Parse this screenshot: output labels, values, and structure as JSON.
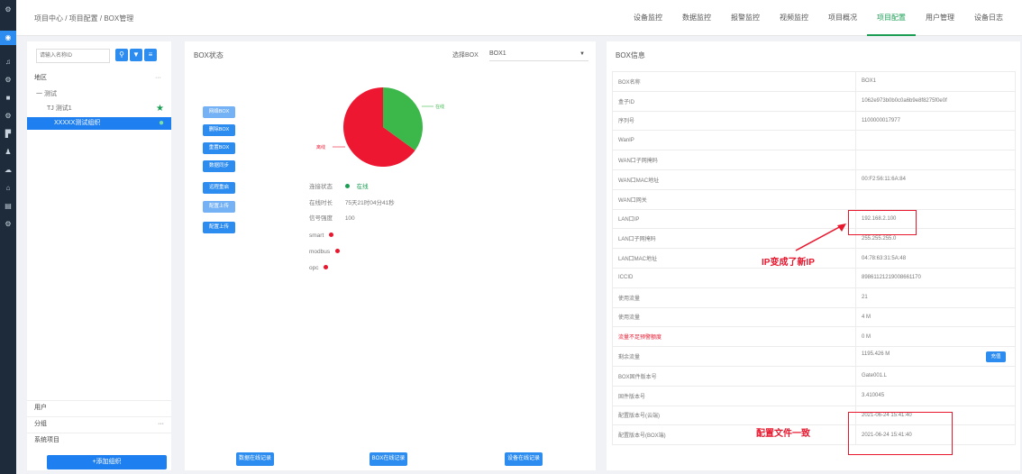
{
  "sidebar_icons": [
    "gear-icon",
    "home-icon",
    "bell-icon",
    "grid-icon",
    "monitor-icon",
    "database-icon",
    "flag-icon",
    "user-icon",
    "cloud-icon",
    "wrench-icon",
    "list-icon",
    "settings-icon"
  ],
  "header": {
    "breadcrumb": "项目中心 / 项目配置 / BOX管理",
    "tabs": [
      "设备监控",
      "数据监控",
      "报警监控",
      "视频监控",
      "项目概况",
      "项目配置",
      "用户管理",
      "设备日志"
    ],
    "active_tab": "项目配置"
  },
  "left": {
    "search_placeholder": "请输入名称ID",
    "group_label": "地区",
    "group_dots": "···",
    "tree": [
      "一 测试",
      "TJ 测试1",
      "XXXXX测试组织"
    ],
    "bottom_items": [
      "用户",
      "分组",
      "系统项目"
    ],
    "bottom_dots": "···",
    "add_button": "+添加组织"
  },
  "middle": {
    "title": "BOX状态",
    "box_select_label": "选择BOX",
    "box_select_value": "BOX1",
    "action_buttons": [
      "网络BOX",
      "删除BOX",
      "重置BOX",
      "数据同步",
      "远程重启",
      "配置上传",
      "配置上传"
    ],
    "pie_labels": {
      "green": "在线",
      "red": "离线"
    },
    "pie_chart": {
      "green_fraction": 0.35,
      "red_fraction": 0.65
    },
    "status": [
      {
        "label": "连接状态",
        "value": "在线"
      },
      {
        "label": "在线时长",
        "value": "75天21时04分41秒"
      },
      {
        "label": "信号强度",
        "value": "100"
      },
      {
        "label": "smart",
        "value": ""
      },
      {
        "label": "modbus",
        "value": ""
      },
      {
        "label": "opc",
        "value": ""
      }
    ],
    "bottom_buttons": [
      "数据在线记录",
      "BOX在线记录",
      "设备在线记录"
    ]
  },
  "right": {
    "title": "BOX信息",
    "rows": [
      {
        "key": "BOX名称",
        "value": "BOX1"
      },
      {
        "key": "盒子ID",
        "value": "1062e973b0b0c0a6b9e8f8275f0e0f"
      },
      {
        "key": "序列号",
        "value": "1100000017977"
      },
      {
        "key": "WanIP",
        "value": ""
      },
      {
        "key": "WAN口子网掩码",
        "value": ""
      },
      {
        "key": "WAN口MAC地址",
        "value": "00:F2:56:11:6A:84"
      },
      {
        "key": "WAN口网关",
        "value": ""
      },
      {
        "key": "LAN口IP",
        "value": "192.168.2.100"
      },
      {
        "key": "LAN口子网掩码",
        "value": "255.255.255.0"
      },
      {
        "key": "LAN口MAC地址",
        "value": "04:78:63:31:5A:48"
      },
      {
        "key": "ICCID",
        "value": "89861121219008661170"
      },
      {
        "key": "使用流量",
        "value": "21"
      },
      {
        "key": "使用流量",
        "value": "4 M"
      },
      {
        "key": "流量不足预警额度",
        "value": "0 M"
      },
      {
        "key": "剩余流量",
        "value": "1195.426 M"
      },
      {
        "key": "BOX固件版本号",
        "value": "Gate001.L"
      },
      {
        "key": "固件版本号",
        "value": "3.410045"
      },
      {
        "key": "配置版本号(云端)",
        "value": "2021-06-24 15:41:40"
      },
      {
        "key": "配置版本号(BOX端)",
        "value": "2021-06-24 15:41:40"
      }
    ],
    "view_button": "充值",
    "annotation_ip": "IP变成了新IP",
    "annotation_config": "配置文件一致"
  },
  "colors": {
    "pie_green": "#3cb84a",
    "pie_red": "#ee1731",
    "accent_blue": "#2d8cf0",
    "annot_red": "#e8172e"
  }
}
